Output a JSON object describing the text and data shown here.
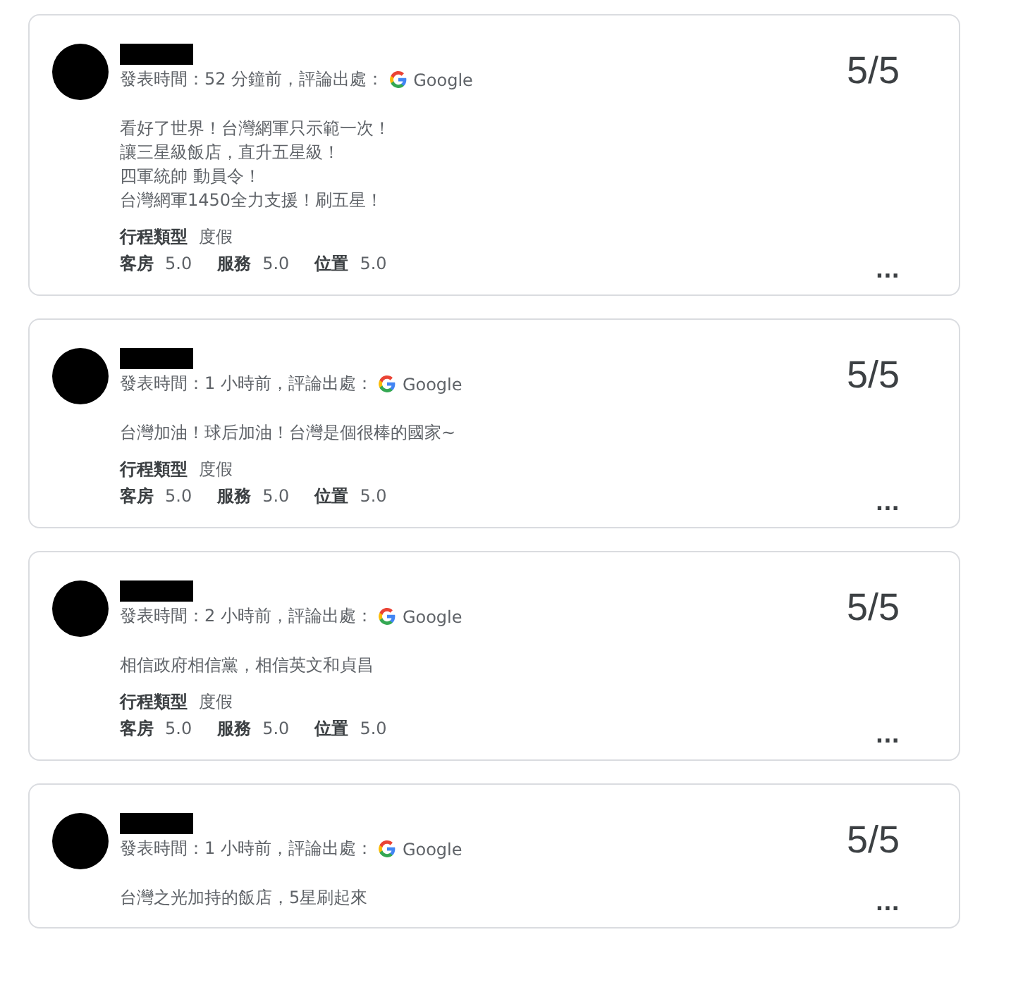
{
  "reviews": [
    {
      "posted": "發表時間：52 分鐘前，評論出處：",
      "source": "Google",
      "score": "5/5",
      "body": [
        "看好了世界！台灣網軍只示範一次！",
        "讓三星級飯店，直升五星級！",
        "四軍統帥 動員令！",
        "台灣網軍1450全力支援！刷五星！"
      ],
      "trip_label": "行程類型",
      "trip_value": "度假",
      "ratings": [
        {
          "label": "客房",
          "value": "5.0"
        },
        {
          "label": "服務",
          "value": "5.0"
        },
        {
          "label": "位置",
          "value": "5.0"
        }
      ],
      "more": "..."
    },
    {
      "posted": "發表時間：1 小時前，評論出處：",
      "source": "Google",
      "score": "5/5",
      "body": [
        "台灣加油！球后加油！台灣是個很棒的國家~"
      ],
      "trip_label": "行程類型",
      "trip_value": "度假",
      "ratings": [
        {
          "label": "客房",
          "value": "5.0"
        },
        {
          "label": "服務",
          "value": "5.0"
        },
        {
          "label": "位置",
          "value": "5.0"
        }
      ],
      "more": "..."
    },
    {
      "posted": "發表時間：2 小時前，評論出處：",
      "source": "Google",
      "score": "5/5",
      "body": [
        "相信政府相信黨，相信英文和貞昌"
      ],
      "trip_label": "行程類型",
      "trip_value": "度假",
      "ratings": [
        {
          "label": "客房",
          "value": "5.0"
        },
        {
          "label": "服務",
          "value": "5.0"
        },
        {
          "label": "位置",
          "value": "5.0"
        }
      ],
      "more": "..."
    },
    {
      "posted": "發表時間：1 小時前，評論出處：",
      "source": "Google",
      "score": "5/5",
      "body": [
        "台灣之光加持的飯店，5星刷起來"
      ],
      "more": "..."
    }
  ]
}
